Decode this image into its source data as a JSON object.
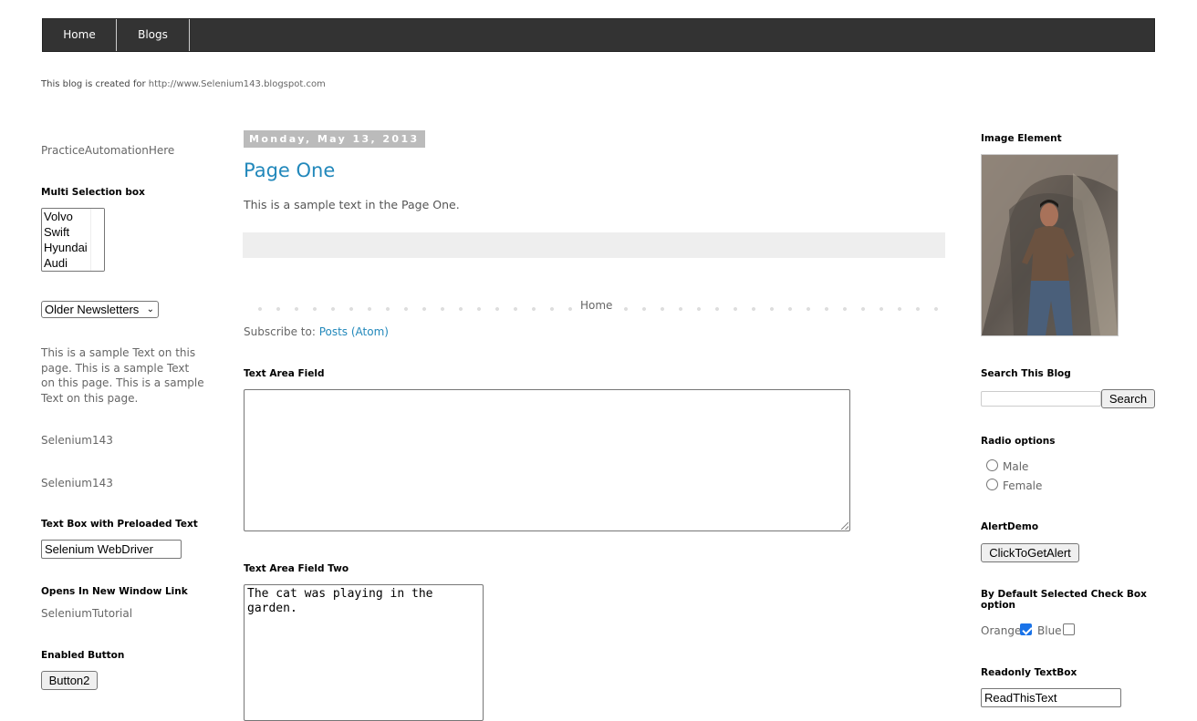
{
  "nav": {
    "items": [
      "Home",
      "Blogs"
    ]
  },
  "header": {
    "description_text": "This blog is created for ",
    "description_link": "http://www.Selenium143.blogspot.com"
  },
  "sidebar_left": {
    "practice_link": "PracticeAutomationHere",
    "multi_select": {
      "title": "Multi Selection box",
      "options": [
        "Volvo",
        "Swift",
        "Hyundai",
        "Audi"
      ]
    },
    "newsletter_select": {
      "selected": "Older Newsletters"
    },
    "sample_text": "This is a sample Text on this page. This is a sample Text on this page. This is a sample Text on this page.",
    "links": [
      "Selenium143",
      "Selenium143"
    ],
    "preloaded": {
      "title": "Text Box with Preloaded Text",
      "value": "Selenium WebDriver"
    },
    "new_window": {
      "title": "Opens In New Window Link",
      "link": "SeleniumTutorial"
    },
    "enabled_button": {
      "title": "Enabled Button",
      "label": "Button2"
    }
  },
  "main": {
    "date_header": "Monday, May 13, 2013",
    "post_title": "Page One",
    "post_body": "This is a sample text in the Page One.",
    "pager_home": "Home",
    "subscribe_label": "Subscribe to: ",
    "subscribe_link": "Posts (Atom)",
    "textarea1": {
      "title": "Text Area Field",
      "value": ""
    },
    "textarea2": {
      "title": "Text Area Field Two",
      "value": "The cat was playing in the\ngarden."
    }
  },
  "sidebar_right": {
    "image": {
      "title": "Image Element"
    },
    "search": {
      "title": "Search This Blog",
      "button": "Search",
      "value": ""
    },
    "radio": {
      "title": "Radio options",
      "options": [
        "Male",
        "Female"
      ]
    },
    "alert": {
      "title": "AlertDemo",
      "button": "ClickToGetAlert"
    },
    "checkbox": {
      "title": "By Default Selected Check Box option",
      "options": [
        {
          "label": "Orange",
          "checked": true
        },
        {
          "label": "Blue",
          "checked": false
        }
      ]
    },
    "readonly": {
      "title": "Readonly TextBox",
      "value": "ReadThisText"
    }
  }
}
